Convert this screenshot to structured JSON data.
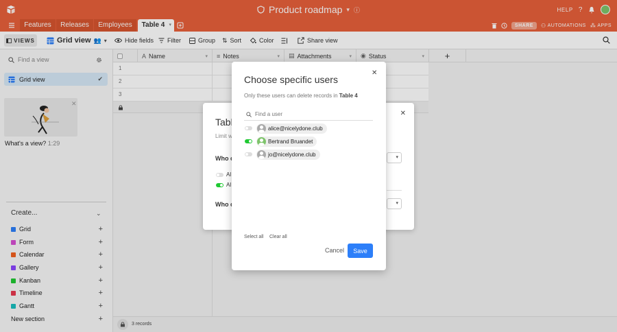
{
  "app": {
    "title": "Product roadmap",
    "help": "HELP",
    "share": "SHARE",
    "automations": "AUTOMATIONS",
    "apps": "APPS"
  },
  "tabs": [
    {
      "label": "Features"
    },
    {
      "label": "Releases"
    },
    {
      "label": "Employees"
    },
    {
      "label": "Table 4"
    }
  ],
  "toolbar": {
    "views": "VIEWS",
    "grid_view": "Grid view",
    "hide_fields": "Hide fields",
    "filter": "Filter",
    "group": "Group",
    "sort": "Sort",
    "color": "Color",
    "share_view": "Share view"
  },
  "sidebar": {
    "find_placeholder": "Find a view",
    "active_view": "Grid view",
    "promo_text": "What's a view?",
    "promo_time": "1:29",
    "create_label": "Create...",
    "create_items": [
      {
        "label": "Grid",
        "color": "#2d7ff9"
      },
      {
        "label": "Form",
        "color": "#d74fd3"
      },
      {
        "label": "Calendar",
        "color": "#f2601f"
      },
      {
        "label": "Gallery",
        "color": "#8b46ff"
      },
      {
        "label": "Kanban",
        "color": "#20c933"
      },
      {
        "label": "Timeline",
        "color": "#e8384f"
      },
      {
        "label": "Gantt",
        "color": "#18bfbf"
      }
    ],
    "new_section": "New section"
  },
  "grid": {
    "columns": [
      "Name",
      "Notes",
      "Attachments",
      "Status"
    ],
    "rows": [
      "1",
      "2",
      "3"
    ],
    "records": "3 records"
  },
  "back_modal": {
    "title": "Table",
    "subtitle": "Limit w",
    "question1": "Who c",
    "option1": "Al",
    "option2": "Al",
    "question2": "Who c"
  },
  "modal": {
    "title": "Choose specific users",
    "desc_prefix": "Only these users can delete records in",
    "desc_table": "Table 4",
    "search_placeholder": "Find a user",
    "users": [
      {
        "name": "alice@nicelydone.club",
        "enabled": false
      },
      {
        "name": "Bertrand Bruandet",
        "enabled": true
      },
      {
        "name": "jo@nicelydone.club",
        "enabled": false
      }
    ],
    "select_all": "Select all",
    "clear_all": "Clear all",
    "cancel": "Cancel",
    "save": "Save"
  },
  "colors": {
    "brand": "#e8603b",
    "primary": "#2d7ff9",
    "toggle_on": "#20c933"
  }
}
